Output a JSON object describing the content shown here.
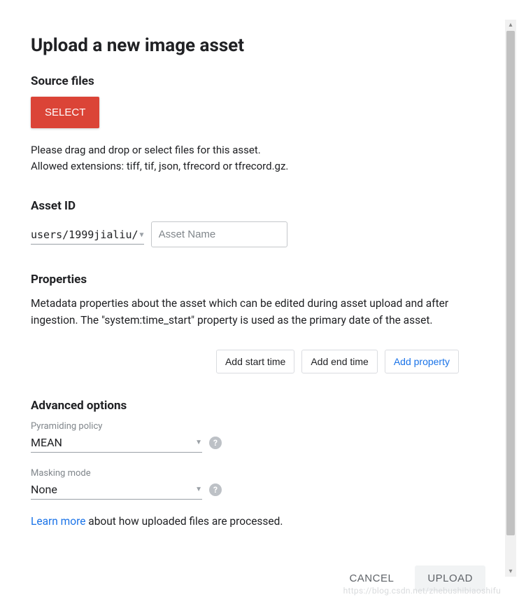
{
  "title": "Upload a new image asset",
  "source": {
    "header": "Source files",
    "select_label": "SELECT",
    "hint_line1": "Please drag and drop or select files for this asset.",
    "hint_line2": "Allowed extensions: tiff, tif, json, tfrecord or tfrecord.gz."
  },
  "asset_id": {
    "header": "Asset ID",
    "prefix": "users/1999jialiu/",
    "placeholder": "Asset Name"
  },
  "properties": {
    "header": "Properties",
    "description": "Metadata properties about the asset which can be edited during asset upload and after ingestion. The \"system:time_start\" property is used as the primary date of the asset.",
    "add_start": "Add start time",
    "add_end": "Add end time",
    "add_prop": "Add property"
  },
  "advanced": {
    "header": "Advanced options",
    "pyramiding_label": "Pyramiding policy",
    "pyramiding_value": "MEAN",
    "masking_label": "Masking mode",
    "masking_value": "None"
  },
  "learn_more": {
    "link": "Learn more",
    "rest": " about how uploaded files are processed."
  },
  "actions": {
    "cancel": "CANCEL",
    "upload": "UPLOAD"
  },
  "watermark": "https://blog.csdn.net/zhebushibiaoshifu"
}
